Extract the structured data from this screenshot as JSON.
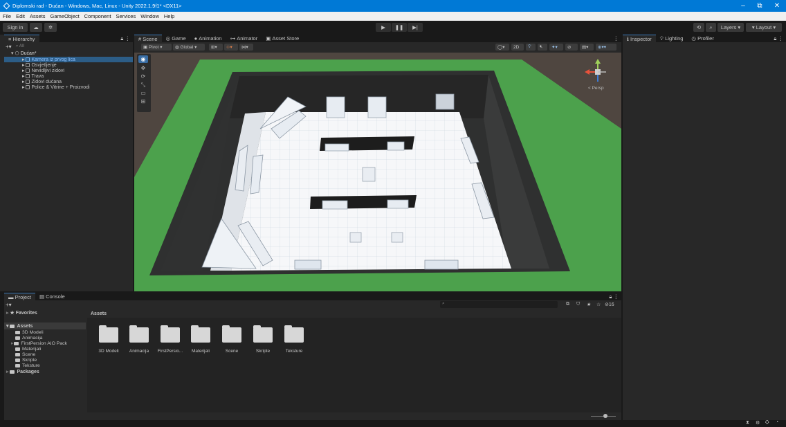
{
  "window": {
    "title": "Diplomski rad - Dućan - Windows, Mac, Linux - Unity 2022.1.9f1* <DX11>",
    "minimize": "–",
    "maximize": "⧉",
    "close": "✕"
  },
  "menu": [
    "File",
    "Edit",
    "Assets",
    "GameObject",
    "Component",
    "Services",
    "Window",
    "Help"
  ],
  "toolbar": {
    "sign_in": "Sign in",
    "play": "▶",
    "pause": "❚❚",
    "step": "▶|",
    "layers": "Layers",
    "layout": "Layout"
  },
  "hierarchy": {
    "tab": "Hierarchy",
    "search_placeholder": "All",
    "add": "+▾",
    "items": [
      {
        "label": "Dućan*",
        "depth": 0
      },
      {
        "label": "Kamera iz prvog lica",
        "depth": 1,
        "selected": true
      },
      {
        "label": "Osvjetljenje",
        "depth": 1
      },
      {
        "label": "Nevidljivi zidovi",
        "depth": 1
      },
      {
        "label": "Trava",
        "depth": 1
      },
      {
        "label": "Zidovi dućana",
        "depth": 1
      },
      {
        "label": "Police & Vitrine + Proizvodi",
        "depth": 1
      }
    ]
  },
  "scene_tabs": [
    "Scene",
    "Game",
    "Animation",
    "Animator",
    "Asset Store"
  ],
  "scene_toolbar": {
    "pivot": "Pivot",
    "global": "Global",
    "mode_2d": "2D",
    "gizmo_view": "< Persp"
  },
  "inspector_tabs": [
    "Inspector",
    "Lighting",
    "Profiler"
  ],
  "bottom_tabs": [
    "Project",
    "Console"
  ],
  "project": {
    "favorites": "Favorites",
    "assets_root": "Assets",
    "packages": "Packages",
    "tree": [
      "3D Modeli",
      "Animacija",
      "FirstPersion AIO Pack",
      "Materijali",
      "Scene",
      "Skripte",
      "Teksture"
    ],
    "breadcrumb": "Assets",
    "folders": [
      "3D Modeli",
      "Animacija",
      "FirstPersio...",
      "Materijali",
      "Scene",
      "Skripte",
      "Teksture"
    ],
    "hidden_count": "16",
    "search_placeholder": ""
  },
  "colors": {
    "accent": "#3a79bb",
    "titlebar": "#0079d6",
    "grass": "#4ca14c",
    "floor": "#f5f6f8",
    "wall": "#2a2b2b"
  }
}
